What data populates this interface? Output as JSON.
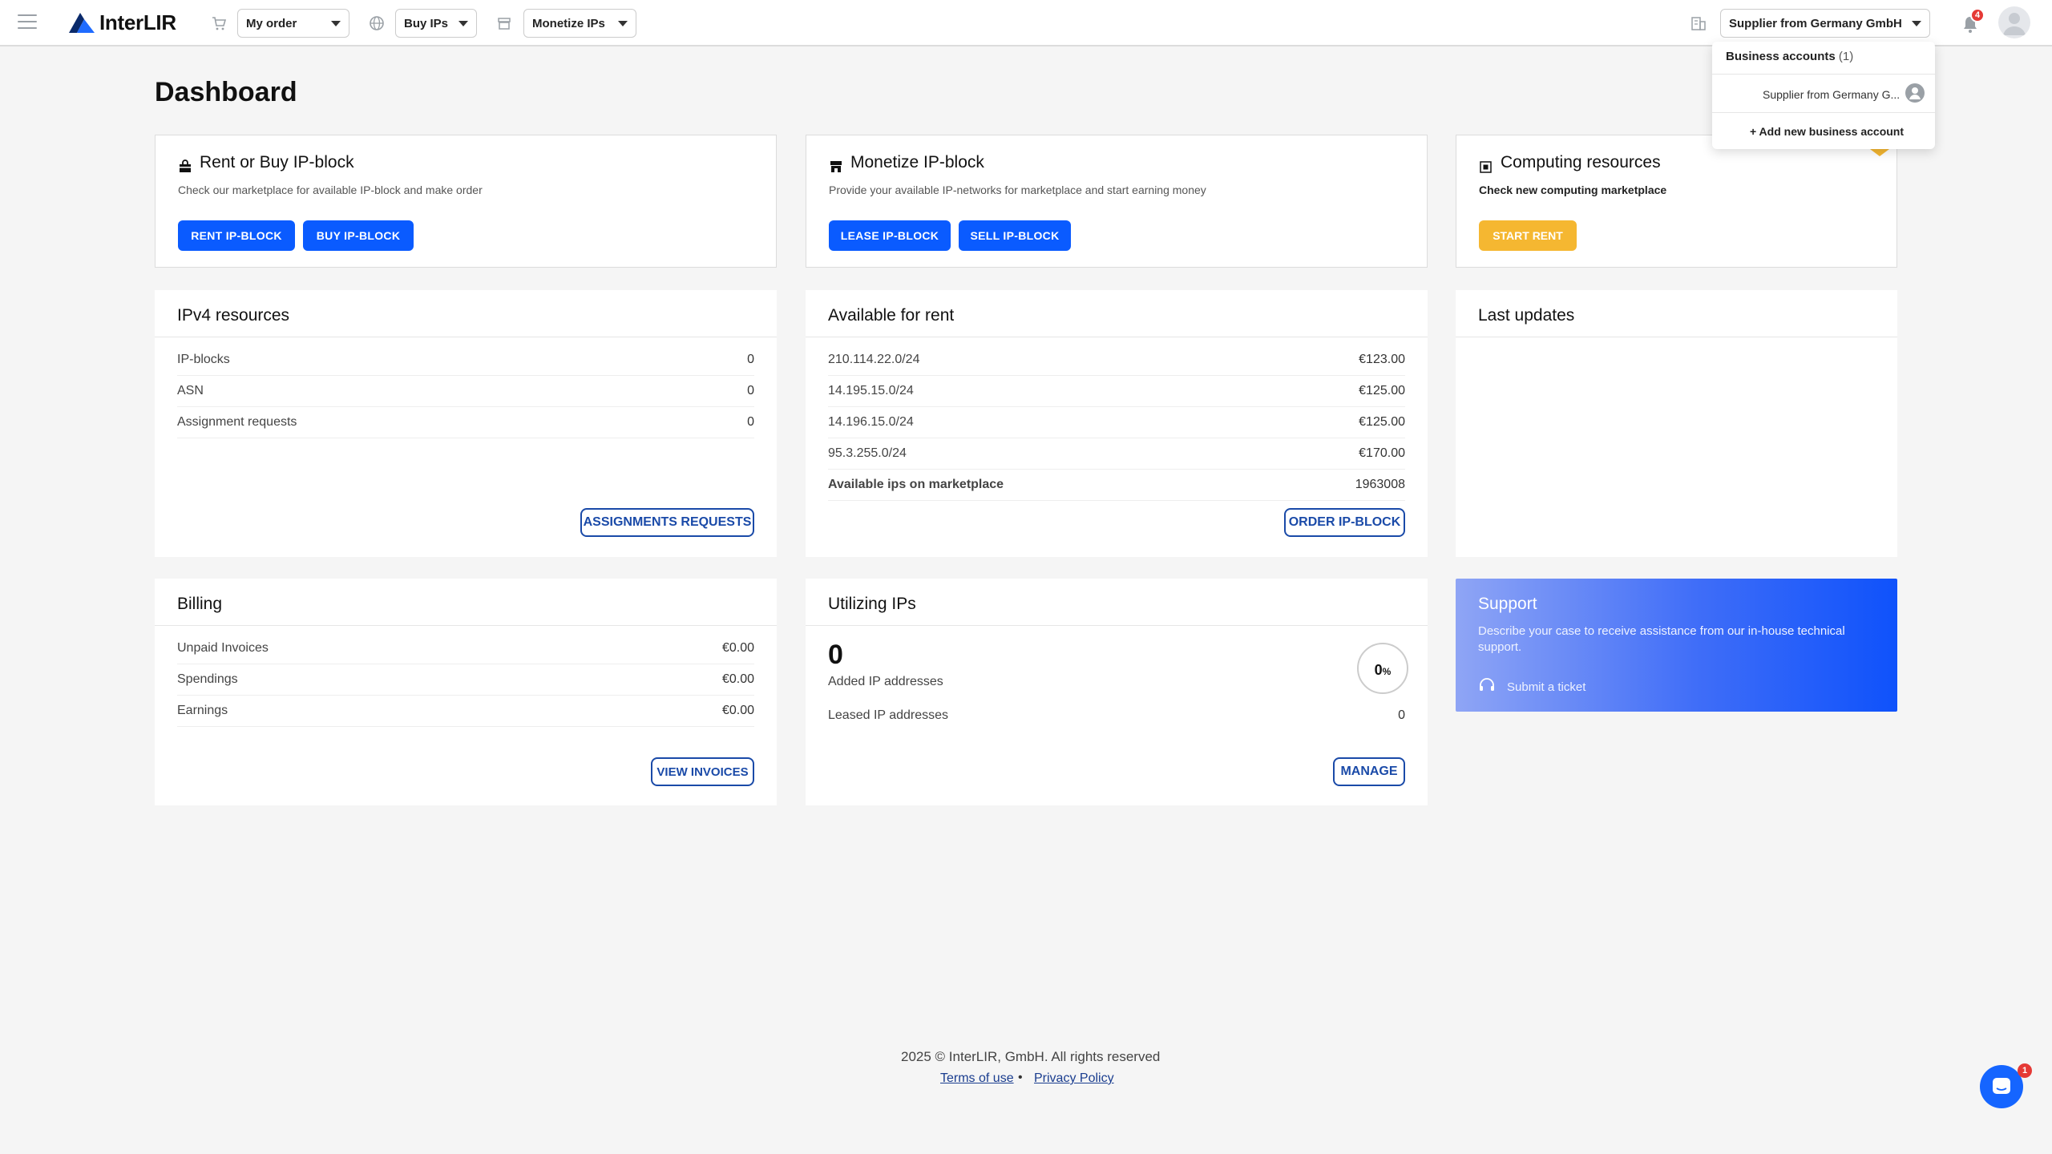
{
  "app": {
    "brand": "InterLIR"
  },
  "topbar": {
    "my_order": "My order",
    "buy_ips": "Buy IPs",
    "monetize_ips": "Monetize IPs",
    "account": "Supplier from Germany GmbH",
    "notification_count": "4"
  },
  "account_dropdown": {
    "header": "Business accounts",
    "count": "(1)",
    "item": "Supplier from Germany G...",
    "add": "+ Add new business account"
  },
  "page": {
    "title": "Dashboard"
  },
  "cards": {
    "rent_buy": {
      "title": "Rent or Buy IP-block",
      "subtitle": "Check our marketplace for available IP-block and make order",
      "btn_rent": "RENT IP-BLOCK",
      "btn_buy": "BUY IP-BLOCK"
    },
    "monetize": {
      "title": "Monetize IP-block",
      "subtitle": "Provide your available IP-networks for marketplace and start earning money",
      "btn_lease": "LEASE IP-BLOCK",
      "btn_sell": "SELL IP-BLOCK"
    },
    "computing": {
      "title": "Computing resources",
      "subtitle": "Check new computing marketplace",
      "btn_start": "START RENT"
    }
  },
  "ipv4": {
    "title": "IPv4 resources",
    "rows": [
      {
        "label": "IP-blocks",
        "value": "0"
      },
      {
        "label": "ASN",
        "value": "0"
      },
      {
        "label": "Assignment requests",
        "value": "0"
      }
    ],
    "button": "ASSIGNMENTS REQUESTS"
  },
  "rent": {
    "title": "Available for rent",
    "rows": [
      {
        "label": "210.114.22.0/24",
        "value": "€123.00"
      },
      {
        "label": "14.195.15.0/24",
        "value": "€125.00"
      },
      {
        "label": "14.196.15.0/24",
        "value": "€125.00"
      },
      {
        "label": "95.3.255.0/24",
        "value": "€170.00"
      }
    ],
    "total_label": "Available ips on marketplace",
    "total_value": "1963008",
    "button": "ORDER IP-BLOCK"
  },
  "updates": {
    "title": "Last updates"
  },
  "billing": {
    "title": "Billing",
    "rows": [
      {
        "label": "Unpaid Invoices",
        "value": "€0.00"
      },
      {
        "label": "Spendings",
        "value": "€0.00"
      },
      {
        "label": "Earnings",
        "value": "€0.00"
      }
    ],
    "button": "VIEW INVOICES"
  },
  "utilizing": {
    "title": "Utilizing IPs",
    "count": "0",
    "added_label": "Added IP addresses",
    "leased_label": "Leased IP addresses",
    "leased_value": "0",
    "percent_value": "0",
    "percent_unit": "%",
    "button": "MANAGE"
  },
  "support": {
    "title": "Support",
    "description": "Describe your case to receive assistance from our in-house technical support.",
    "link": "Submit a ticket"
  },
  "footer": {
    "copyright": "2025 © InterLIR, GmbH. All rights reserved",
    "terms": "Terms of use",
    "dot": "•",
    "privacy": "Privacy Policy"
  },
  "chat": {
    "badge": "1"
  },
  "colors": {
    "primary": "#0a5bff",
    "accent": "#f5b731",
    "outline": "#1a4aa8"
  }
}
